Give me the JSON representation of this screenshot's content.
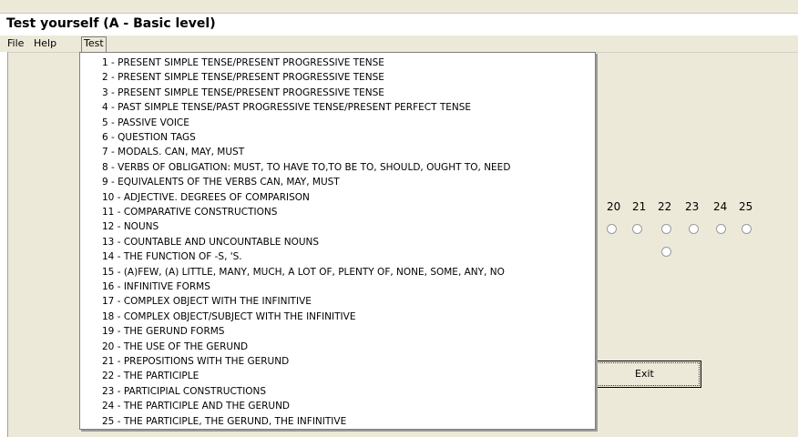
{
  "window": {
    "title": "Test yourself (A - Basic level)"
  },
  "menubar": {
    "items": [
      "File",
      "Help",
      "Test"
    ]
  },
  "test_menu": {
    "items": [
      "1 - PRESENT SIMPLE TENSE/PRESENT PROGRESSIVE TENSE",
      "2 - PRESENT SIMPLE TENSE/PRESENT PROGRESSIVE TENSE",
      "3 - PRESENT SIMPLE TENSE/PRESENT PROGRESSIVE TENSE",
      "4 - PAST SIMPLE TENSE/PAST PROGRESSIVE TENSE/PRESENT PERFECT TENSE",
      "5 - PASSIVE VOICE",
      "6 - QUESTION TAGS",
      "7 - MODALS. CAN, MAY, MUST",
      "8 - VERBS OF OBLIGATION: MUST, TO HAVE TO,TO BE TO, SHOULD, OUGHT TO, NEED",
      "9 - EQUIVALENTS OF THE VERBS CAN, MAY, MUST",
      "10 - ADJECTIVE. DEGREES OF COMPARISON",
      "11 - COMPARATIVE CONSTRUCTIONS",
      "12 - NOUNS",
      "13 - COUNTABLE AND UNCOUNTABLE NOUNS",
      "14 - THE FUNCTION OF -S, 'S.",
      "15 - (A)FEW, (A) LITTLE, MANY, MUCH, A LOT OF, PLENTY OF, NONE, SOME, ANY, NO",
      "16 - INFINITIVE FORMS",
      "17 - COMPLEX OBJECT WITH THE INFINITIVE",
      "18 - COMPLEX OBJECT/SUBJECT WITH THE INFINITIVE",
      "19 - THE GERUND FORMS",
      "20 - THE USE OF THE GERUND",
      "21 - PREPOSITIONS WITH THE GERUND",
      "22 - THE PARTICIPLE",
      "23 - PARTICIPIAL CONSTRUCTIONS",
      "24 - THE PARTICIPLE AND THE GERUND",
      "25 - THE PARTICIPLE, THE GERUND, THE INFINITIVE"
    ]
  },
  "question_numbers": [
    "20",
    "21",
    "22",
    "23",
    "24",
    "25"
  ],
  "buttons": {
    "exit": "Exit"
  },
  "colors": {
    "window_bg": "#ece9d8",
    "menu_bg": "#ffffff"
  }
}
